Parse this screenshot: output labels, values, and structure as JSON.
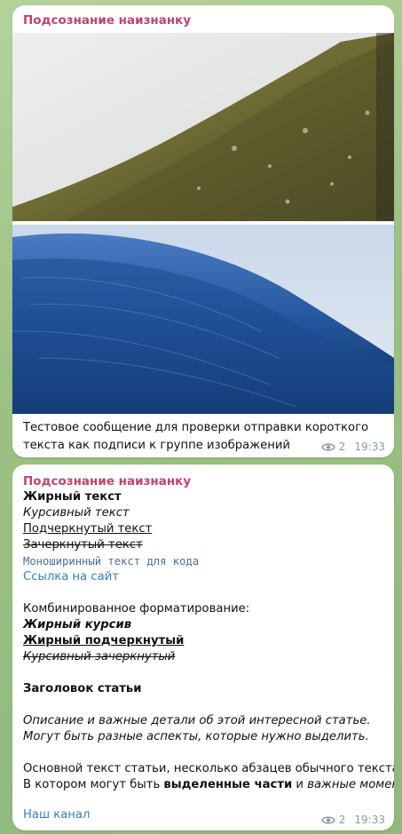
{
  "post1": {
    "channel": "Подсознание наизнанку",
    "caption": "Тестовое сообщение для проверки отправки короткого текста как подписи к группе изображений",
    "views": "2",
    "time": "19:33"
  },
  "post2": {
    "channel": "Подсознание наизнанку",
    "bold": "Жирный текст",
    "italic": "Курсивный текст",
    "underline": "Подчеркнутый текст",
    "strike": "Зачеркнутый текст",
    "mono": "Моноширинный текст для кода",
    "link": "Ссылка на сайт",
    "combined_title": "Комбинированное форматирование:",
    "bold_italic": "Жирный курсив",
    "bold_underline": "Жирный подчеркнутый",
    "italic_strike": "Курсивный зачеркнутый",
    "heading": "Заголовок статьи",
    "description": "Описание и важные детали об этой интересной статье. Могут быть разные аспекты, которые нужно выделить.",
    "body_part1": "Основной текст статьи, несколько абзацев обычного текста.",
    "body_part2_prefix": "В котором могут быть ",
    "body_part2_bold": "выделенные части",
    "body_part2_mid": " и ",
    "body_part2_italic": "важные моменты",
    "body_part2_suffix": ".",
    "channel_link": "Наш канал",
    "views": "2",
    "time": "19:33"
  },
  "icons": {
    "views": "eye-icon"
  }
}
